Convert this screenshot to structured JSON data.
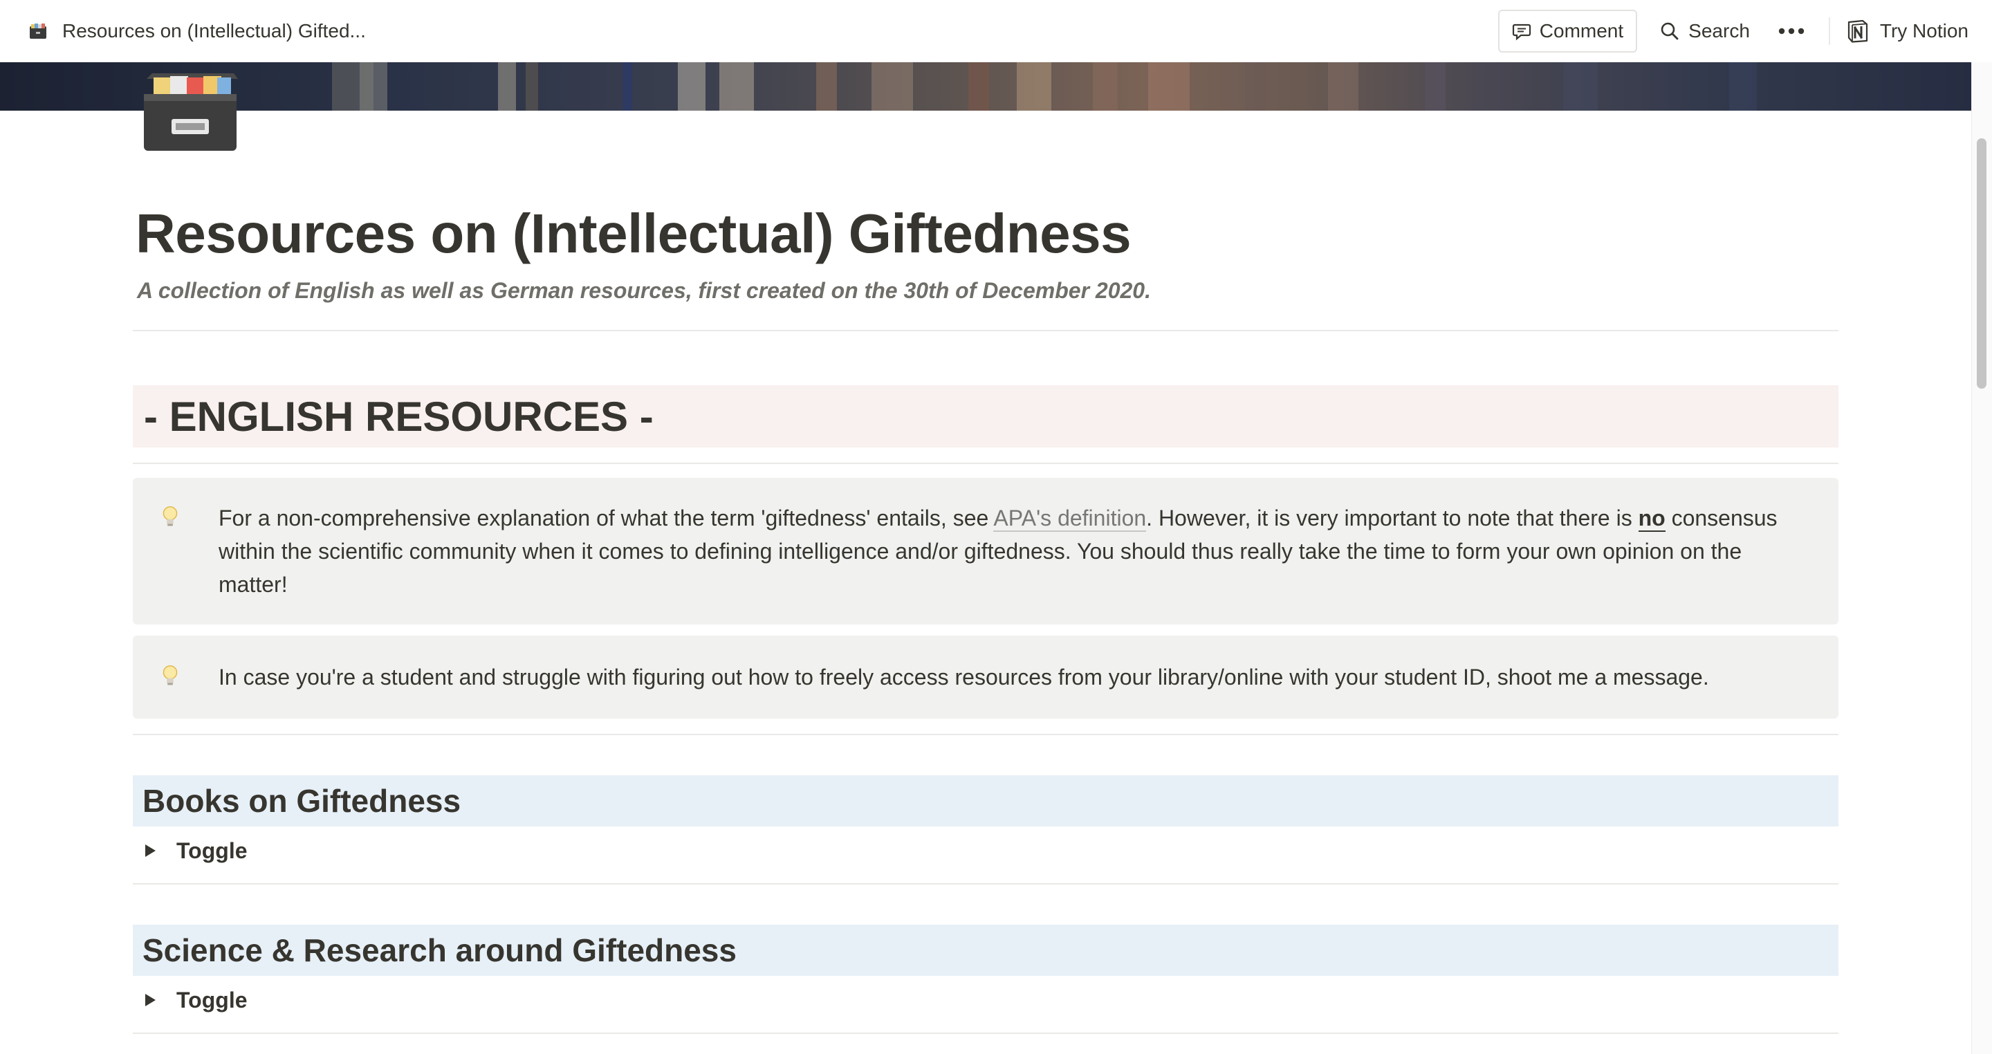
{
  "topbar": {
    "page_title": "Resources on (Intellectual) Gifted...",
    "comment_label": "Comment",
    "search_label": "Search",
    "more_label": "•••",
    "try_notion_label": "Try Notion"
  },
  "page": {
    "title": "Resources on (Intellectual) Giftedness",
    "subtitle": "A collection of English as well as German resources, first created on the 30th of December 2020.",
    "section_heading": "- ENGLISH RESOURCES -"
  },
  "callouts": [
    {
      "icon": "lightbulb-icon",
      "text_before_link": "For a non-comprehensive explanation of what the term 'giftedness' entails, see ",
      "link_text": "APA's definition",
      "text_after_link": ". However, it is very important to note that there is ",
      "bold_text": "no",
      "text_end": " consensus within the scientific community when it comes to defining intelligence and/or giftedness. You should thus really take the time to form your own opinion on the matter!"
    },
    {
      "icon": "lightbulb-icon",
      "text": "In case you're a student and struggle with figuring out how to freely access resources from your library/online with your student ID, shoot me a message."
    }
  ],
  "sections": [
    {
      "heading": "Books on Giftedness",
      "toggle_label": "Toggle"
    },
    {
      "heading": "Science & Research around Giftedness",
      "toggle_label": "Toggle"
    }
  ],
  "colors": {
    "text": "#37352f",
    "h1_background": "#f9f0f0",
    "h2_background": "#e7f0f7",
    "callout_background": "#f1f1ef"
  }
}
